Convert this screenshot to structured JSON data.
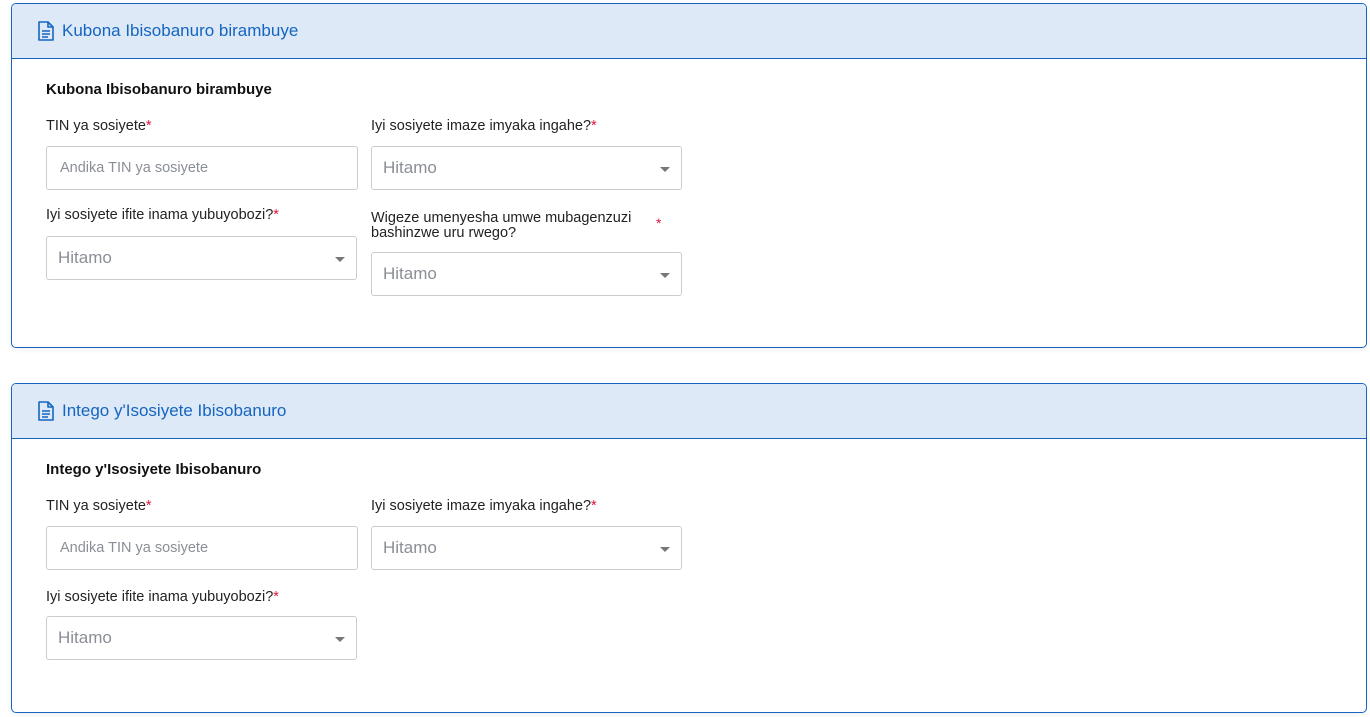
{
  "sections": [
    {
      "header_title": "Kubona Ibisobanuro birambuye",
      "section_title": "Kubona Ibisobanuro birambuye",
      "tin_label": "TIN ya sosiyete",
      "tin_placeholder": "Andika TIN ya sosiyete",
      "years_label": "Iyi sosiyete imaze imyaka ingahe?",
      "years_value": "Hitamo",
      "board_label": "Iyi sosiyete ifite inama yubuyobozi?",
      "board_value": "Hitamo",
      "auditor_label": "Wigeze umenyesha umwe mubagenzuzi bashinzwe uru rwego?",
      "auditor_value": "Hitamo"
    },
    {
      "header_title": "Intego y'Isosiyete Ibisobanuro",
      "section_title": "Intego y'Isosiyete Ibisobanuro",
      "tin_label": "TIN ya sosiyete",
      "tin_placeholder": "Andika TIN ya sosiyete",
      "years_label": "Iyi sosiyete imaze imyaka ingahe?",
      "years_value": "Hitamo",
      "board_label": "Iyi sosiyete ifite inama yubuyobozi?",
      "board_value": "Hitamo"
    }
  ],
  "required_marker": "*",
  "icons": {
    "header": "document-icon",
    "dropdown": "caret-down-icon"
  },
  "colors": {
    "accent": "#1565c0",
    "header_bg": "#dde9f7",
    "required": "#e0143c",
    "placeholder": "#8a8f96"
  }
}
